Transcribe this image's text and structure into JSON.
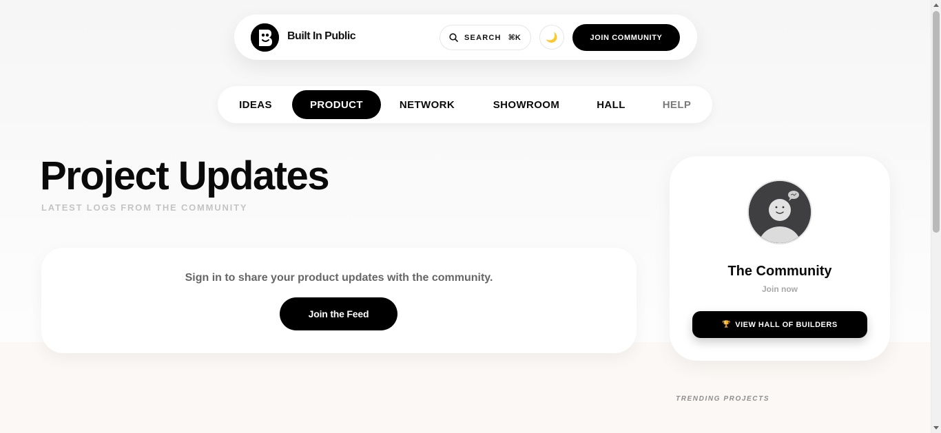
{
  "header": {
    "brand_name": "Built In Public",
    "search_label": "SEARCH",
    "search_shortcut": "⌘K",
    "theme_icon": "🌙",
    "join_label": "JOIN COMMUNITY"
  },
  "tabs": [
    {
      "label": "IDEAS",
      "active": false
    },
    {
      "label": "PRODUCT",
      "active": true
    },
    {
      "label": "NETWORK",
      "active": false
    },
    {
      "label": "SHOWROOM",
      "active": false
    },
    {
      "label": "HALL",
      "active": false
    },
    {
      "label": "HELP",
      "active": false
    }
  ],
  "main": {
    "title": "Project Updates",
    "subtitle": "LATEST LOGS FROM THE COMMUNITY",
    "signin_prompt": "Sign in to share your product updates with the community.",
    "feed_button_label": "Join the Feed"
  },
  "community": {
    "name": "The Community",
    "subtitle": "Join now",
    "hall_button_label": "VIEW HALL OF BUILDERS",
    "hall_button_icon": "🏆"
  },
  "trending": {
    "label": "TRENDING PROJECTS"
  },
  "colors": {
    "accent": "#000000",
    "page_background": "#f6f6f6",
    "lower_band": "#fcf8f5",
    "muted_text": "#c4c4c4"
  }
}
